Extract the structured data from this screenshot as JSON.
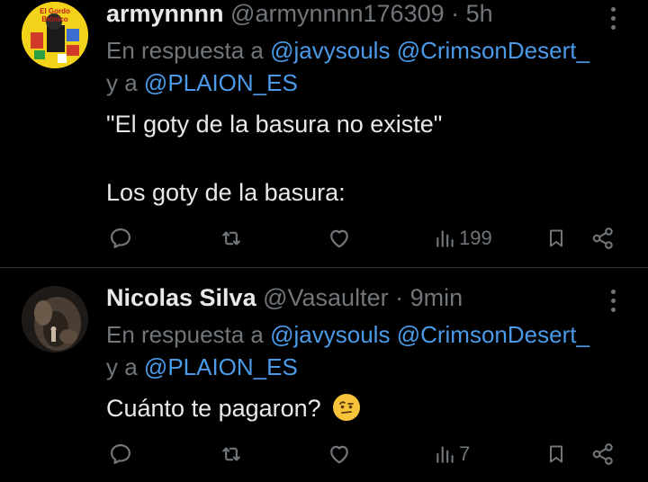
{
  "tweets": [
    {
      "display_name": "armynnnn",
      "handle": "@armynnnn176309",
      "separator": "·",
      "time": "5h",
      "reply_prefix": "En respuesta a",
      "mention1": "@javysouls",
      "mention2": "@CrimsonDesert_",
      "reply_and": "y a",
      "mention3": "@PLAION_ES",
      "text_line1": "\"El goty de la basura no existe\"",
      "text_line2": "Los goty de la basura:",
      "views": "199",
      "avatar_caption_line1": "El Gordo",
      "avatar_caption_line2": "Biónico"
    },
    {
      "display_name": "Nicolas Silva",
      "handle": "@Vasaulter",
      "separator": "·",
      "time": "9min",
      "reply_prefix": "En respuesta a",
      "mention1": "@javysouls",
      "mention2": "@CrimsonDesert_",
      "reply_and": "y a",
      "mention3": "@PLAION_ES",
      "text_line1": "Cuánto te pagaron?",
      "views": "7"
    }
  ],
  "icons": {
    "reply": "comment-icon",
    "retweet": "retweet-icon",
    "like": "heart-icon",
    "views": "views-bar-chart-icon",
    "bookmark": "bookmark-icon",
    "share": "share-icon",
    "more": "more-vertical-icon",
    "emoji": "raised-eyebrow-face-emoji"
  },
  "colors": {
    "background": "#000000",
    "text": "#e7e9ea",
    "muted": "#71767b",
    "link": "#4a9ae8",
    "divider": "#2f3336"
  }
}
